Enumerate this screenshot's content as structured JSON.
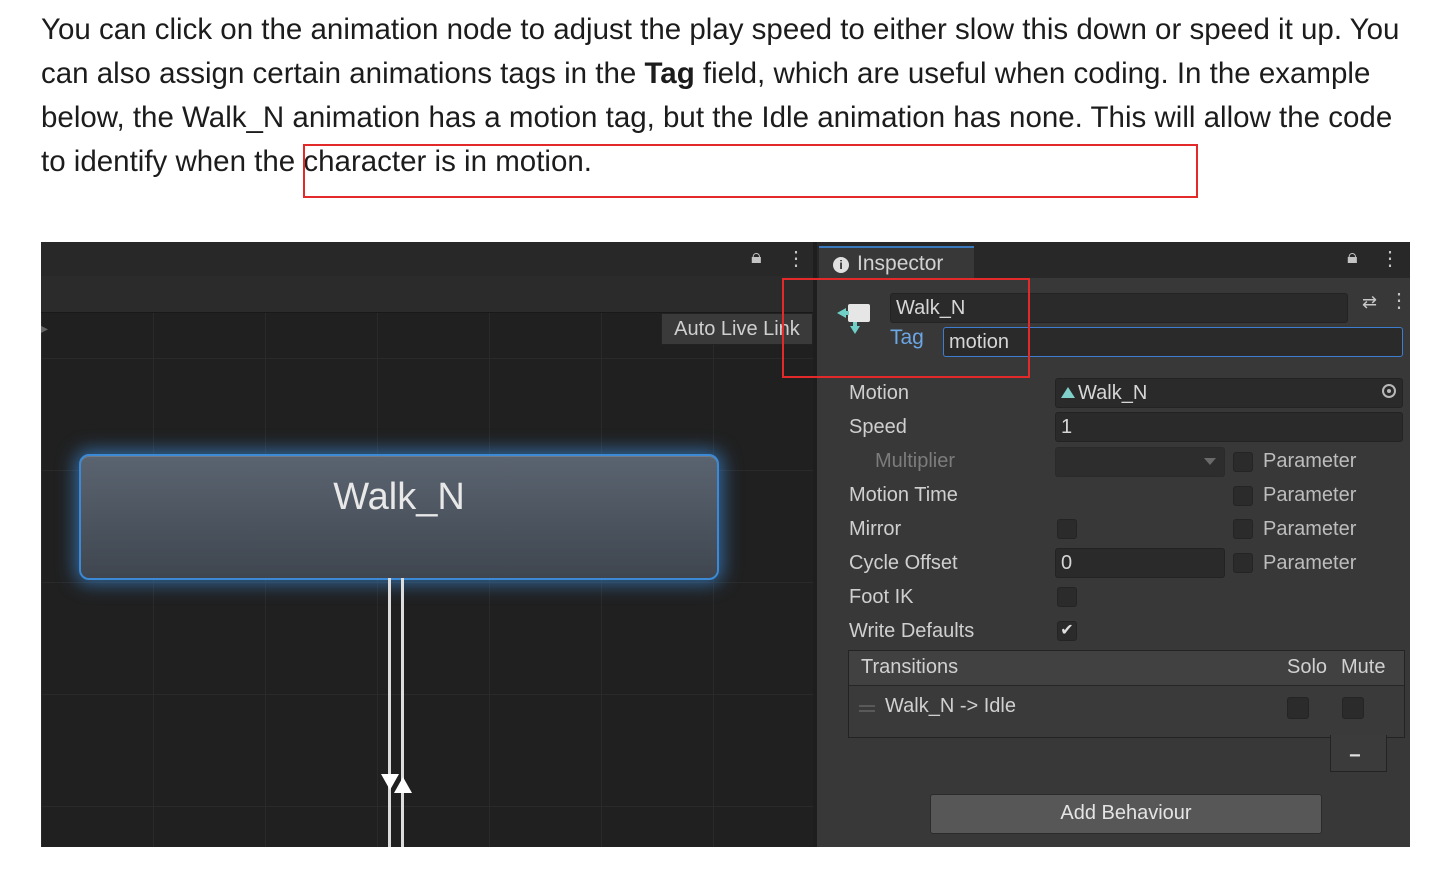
{
  "article": {
    "text_1": "You can click on the animation node to adjust the play speed to either slow this down or speed it up. You can also assign certain animations tags in the ",
    "bold_word": "Tag",
    "text_2": " field, which are useful when coding. In the example below, the Walk_N animation has a motion tag, but the Idle animation has none. This will allow the code to identify when the character is in motion."
  },
  "graph": {
    "auto_live_link": "Auto Live Link",
    "node_label": "Walk_N"
  },
  "inspector": {
    "tab_title": "Inspector",
    "state_name": "Walk_N",
    "tag_label": "Tag",
    "tag_value": "motion",
    "rows": {
      "motion_label": "Motion",
      "motion_value": "Walk_N",
      "speed_label": "Speed",
      "speed_value": "1",
      "multiplier_label": "Multiplier",
      "motion_time_label": "Motion Time",
      "mirror_label": "Mirror",
      "cycle_offset_label": "Cycle Offset",
      "cycle_offset_value": "0",
      "foot_ik_label": "Foot IK",
      "write_defaults_label": "Write Defaults",
      "write_defaults_checked": true,
      "parameter_label": "Parameter"
    },
    "transitions": {
      "title": "Transitions",
      "solo": "Solo",
      "mute": "Mute",
      "items": [
        "Walk_N -> Idle"
      ],
      "remove_label": "−"
    },
    "add_behaviour": "Add Behaviour"
  },
  "colors": {
    "highlight": "#e32a2a",
    "node_glow": "#3c8ad6",
    "tag_label": "#6ca6e4"
  }
}
